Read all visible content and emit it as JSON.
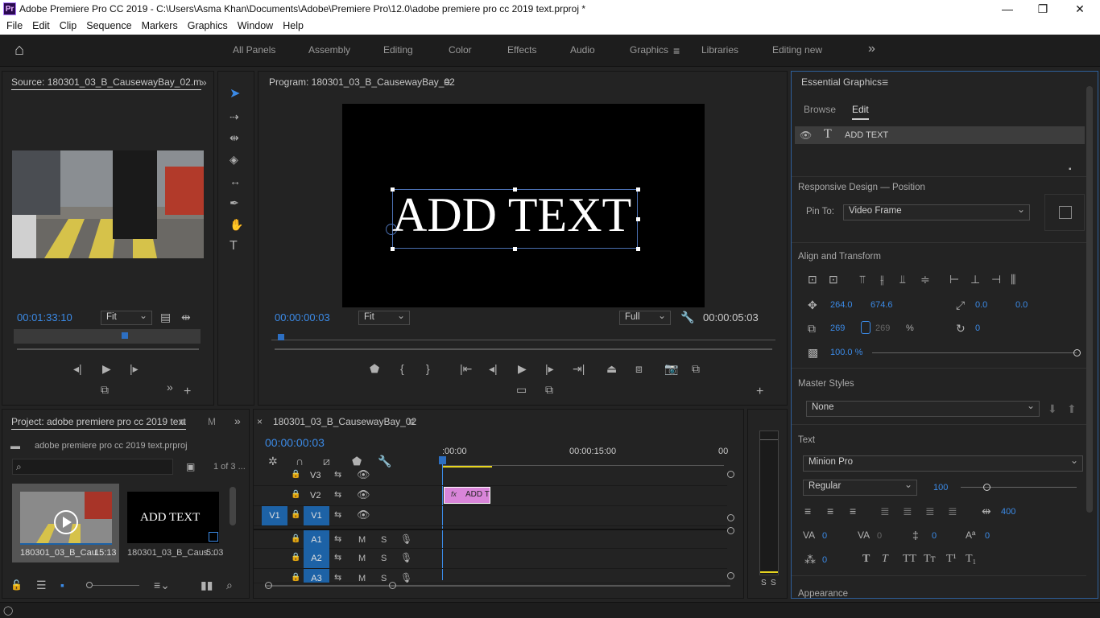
{
  "window": {
    "logo": "Pr",
    "title": "Adobe Premiere Pro CC 2019 - C:\\Users\\Asma Khan\\Documents\\Adobe\\Premiere Pro\\12.0\\adobe premiere pro cc 2019 text.prproj *",
    "minimize": "—",
    "maximize": "❐",
    "close": "✕"
  },
  "menu": [
    "File",
    "Edit",
    "Clip",
    "Sequence",
    "Markers",
    "Graphics",
    "Window",
    "Help"
  ],
  "workspaces": [
    "All Panels",
    "Assembly",
    "Editing",
    "Color",
    "Effects",
    "Audio",
    "Graphics",
    "Libraries",
    "Editing new"
  ],
  "workspace_active": "Graphics",
  "overflow": "»",
  "home_icon": "⌂",
  "source": {
    "title": "Source: 180301_03_B_CausewayBay_02.m",
    "timecode": "00:01:33:10",
    "fit": "Fit",
    "thumb_alt": "street scene"
  },
  "program": {
    "title": "Program: 180301_03_B_CausewayBay_02",
    "text": "ADD TEXT",
    "timecode_left": "00:00:00:03",
    "fit": "Fit",
    "quality": "Full",
    "timecode_right": "00:00:05:03"
  },
  "project": {
    "title": "Project: adobe premiere pro cc 2019 text",
    "extra_tab": "M",
    "file": "adobe premiere pro cc 2019 text.prproj",
    "count": "1 of 3 ...",
    "items": [
      {
        "name": "180301_03_B_Cau...",
        "duration": "15:13"
      },
      {
        "name": "180301_03_B_Caus...",
        "duration": "5:03",
        "thumb_text": "ADD TEXT"
      }
    ]
  },
  "timeline": {
    "title": "180301_03_B_CausewayBay_02",
    "timecode": "00:00:00:03",
    "ruler": [
      ":00:00",
      "00:00:15:00",
      "00"
    ],
    "clip_label": "ADD T",
    "clip_fx": "fx",
    "tracks": [
      {
        "name": "V3",
        "type": "video"
      },
      {
        "name": "V2",
        "type": "video"
      },
      {
        "name": "V1",
        "type": "video",
        "src": "V1"
      },
      {
        "name": "A1",
        "type": "audio"
      },
      {
        "name": "A2",
        "type": "audio"
      },
      {
        "name": "A3",
        "type": "audio"
      }
    ],
    "m": "M",
    "s": "S"
  },
  "meter": {
    "s1": "S",
    "s2": "S"
  },
  "eg": {
    "title": "Essential Graphics",
    "tabs": [
      "Browse",
      "Edit"
    ],
    "active_tab": "Edit",
    "layer": "ADD TEXT",
    "responsive_header": "Responsive Design — Position",
    "pin_to_label": "Pin To:",
    "pin_to_value": "Video Frame",
    "align_header": "Align and Transform",
    "pos_x": "264.0",
    "pos_y": "674.6",
    "anchor_x": "0.0",
    "anchor_y": "0.0",
    "scale_w": "269",
    "scale_h": "269",
    "scale_unit": "%",
    "rotation": "0",
    "opacity": "100.0 %",
    "master_header": "Master Styles",
    "master_value": "None",
    "text_header": "Text",
    "font": "Minion Pro",
    "style": "Regular",
    "size": "100",
    "tracking": "400",
    "kerning": "0",
    "tracking2": "0",
    "leading": "0",
    "baseline": "0",
    "tsume": "0",
    "type_buttons": [
      "T",
      "T",
      "TT",
      "Tт",
      "T¹",
      "T₁"
    ],
    "appearance_header": "Appearance"
  },
  "colors": {
    "accent": "#3b8ae6",
    "clip": "#d985d9",
    "track_box": "#1d62a6"
  }
}
